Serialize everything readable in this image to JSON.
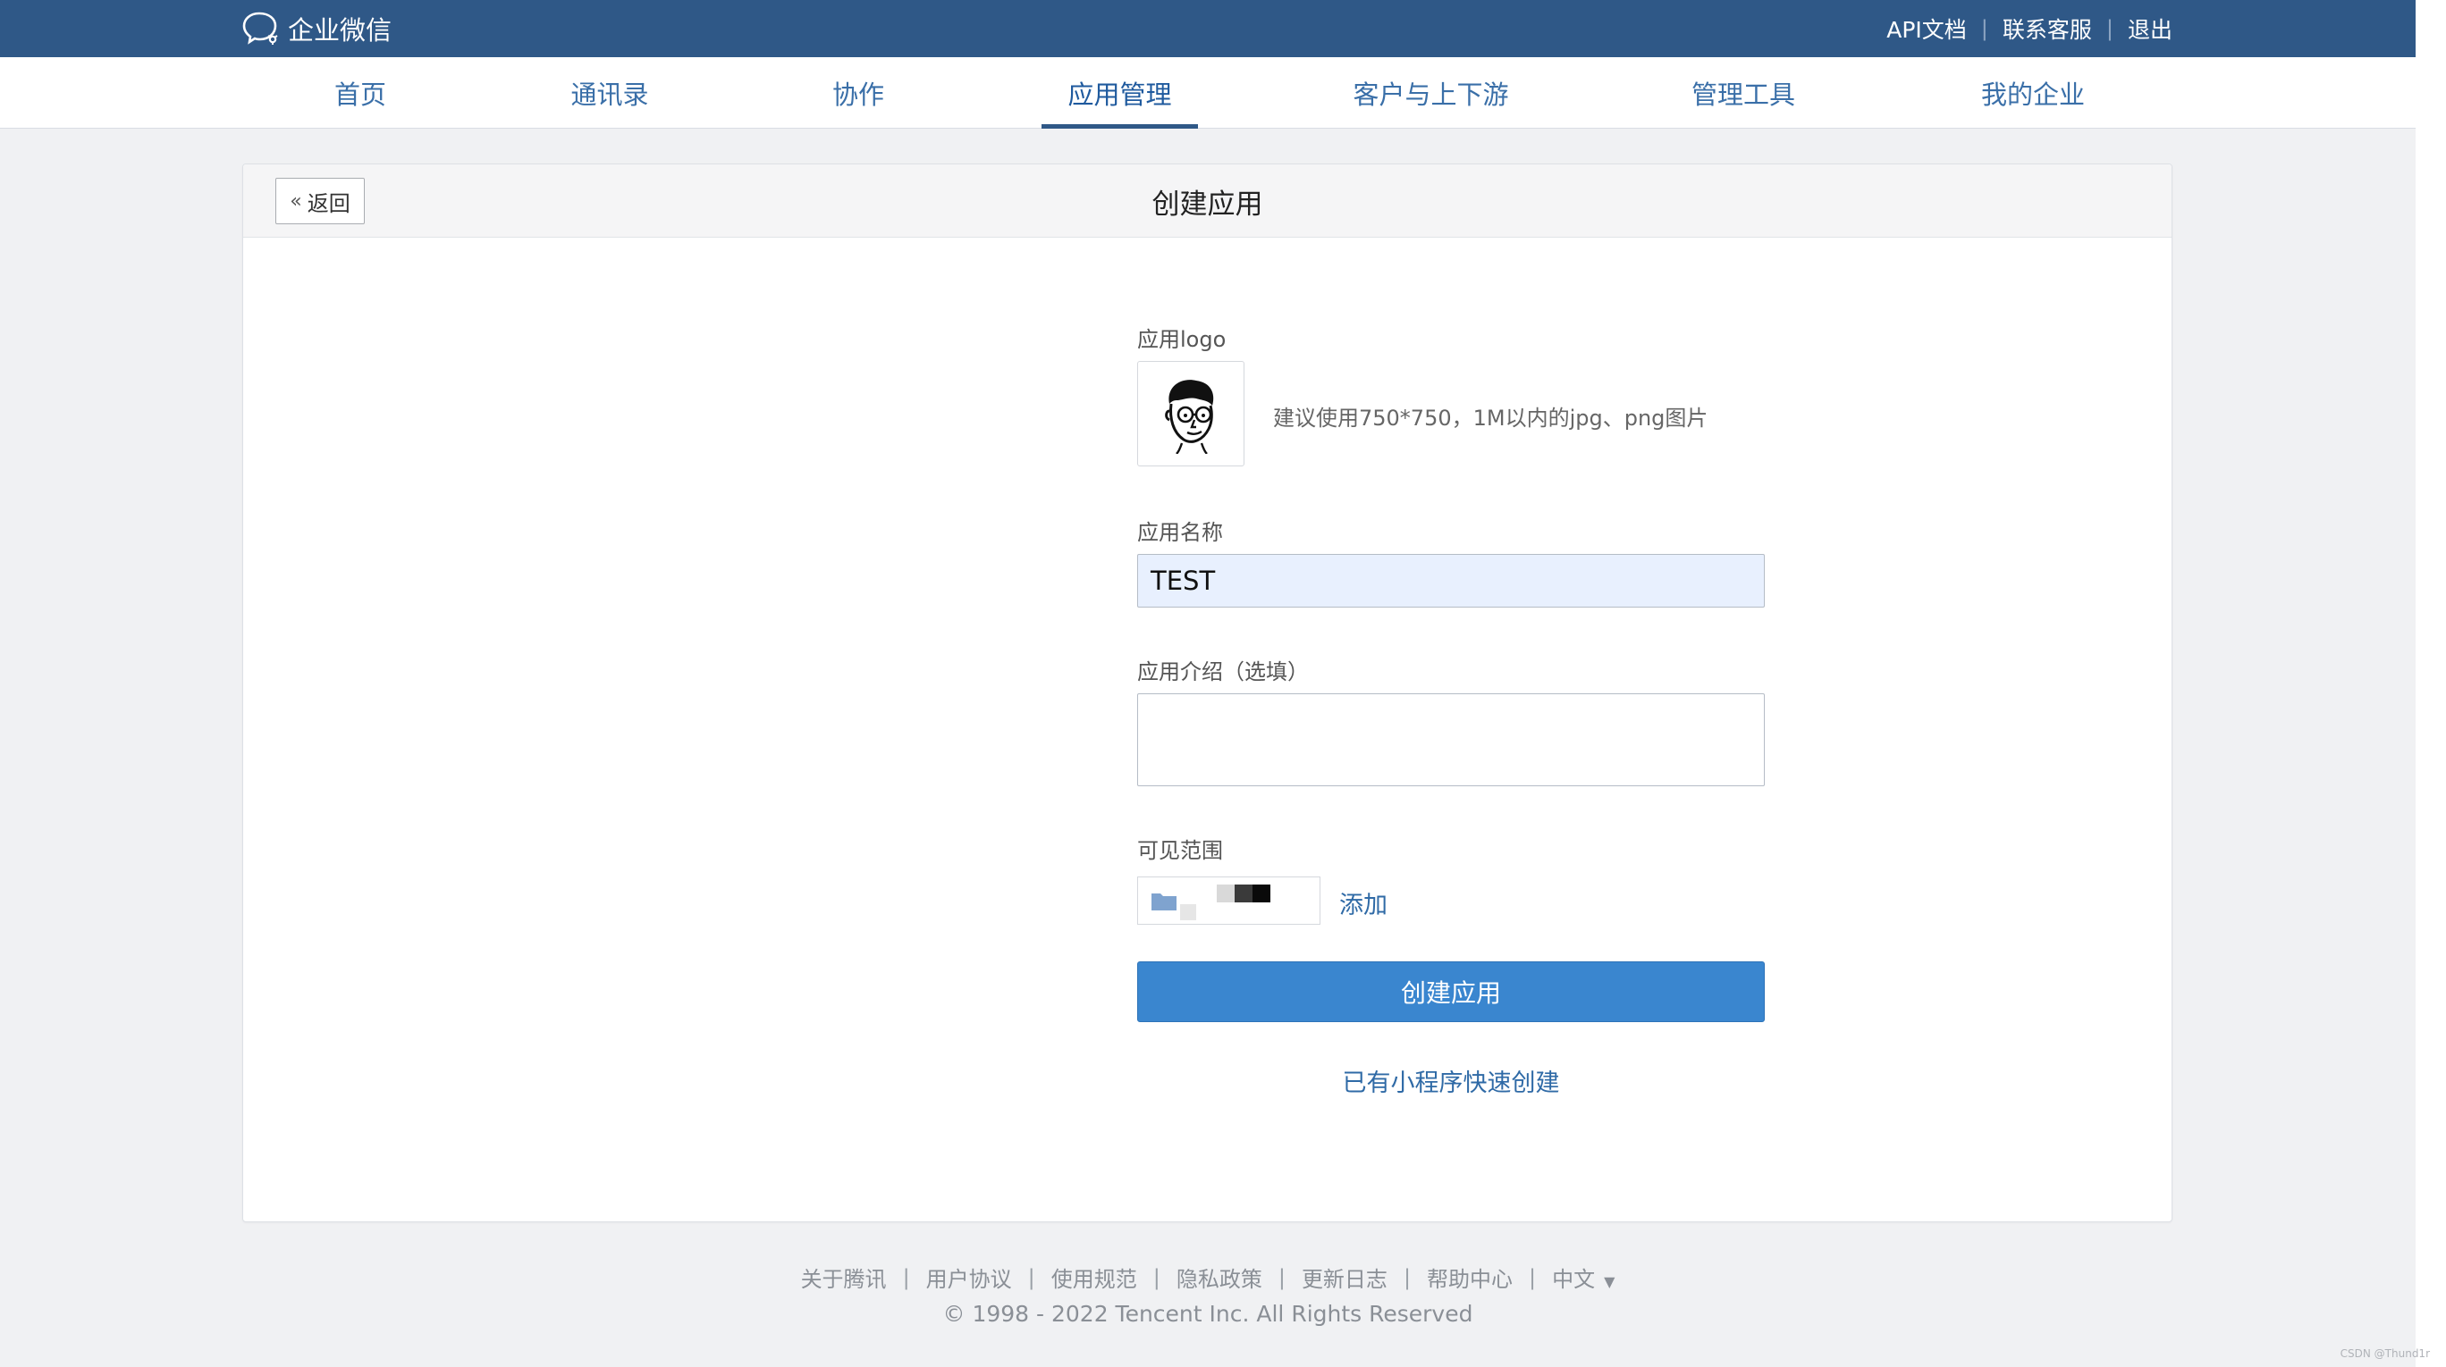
{
  "brand": {
    "name": "企业微信"
  },
  "top_links": [
    "API文档",
    "联系客服",
    "退出"
  ],
  "nav": {
    "items": [
      "首页",
      "通讯录",
      "协作",
      "应用管理",
      "客户与上下游",
      "管理工具",
      "我的企业"
    ],
    "active": "应用管理"
  },
  "card": {
    "back_label": "返回",
    "title": "创建应用"
  },
  "form": {
    "logo_label": "应用logo",
    "logo_hint": "建议使用750*750，1M以内的jpg、png图片",
    "name_label": "应用名称",
    "name_value": "TEST",
    "desc_label": "应用介绍（选填）",
    "desc_value": "",
    "scope_label": "可见范围",
    "add_label": "添加",
    "create_button": "创建应用",
    "mini_program_link": "已有小程序快速创建"
  },
  "footer": {
    "links": [
      "关于腾讯",
      "用户协议",
      "使用规范",
      "隐私政策",
      "更新日志",
      "帮助中心",
      "中文"
    ],
    "copyright": "© 1998 - 2022 Tencent Inc. All Rights Reserved"
  },
  "watermark": "CSDN @Thund1r",
  "colors": {
    "topbar": "#2f5887",
    "link": "#2f6aa6",
    "primary_button": "#3a86cf",
    "input_autofill": "#e8f0fe"
  }
}
